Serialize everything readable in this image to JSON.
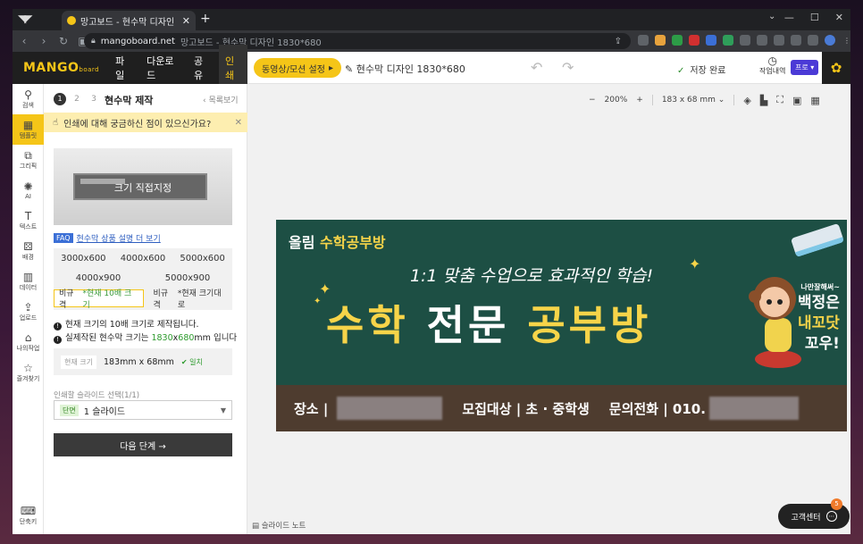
{
  "browser": {
    "tab_title": "망고보드 - 현수막 디자인 1",
    "url_host": "mangoboard.net",
    "url_rest": "망고보드 - 현수막 디자인 1830*680"
  },
  "header": {
    "logo": "MANGO",
    "logo_sub": "board",
    "menu": [
      "파일",
      "다운로드",
      "공유",
      "인쇄"
    ],
    "video_button": "동영상/모션 설정",
    "doc_title": "현수막 디자인 1830*680",
    "save_status": "저장 완료",
    "history": "작업내역",
    "pro_badge": "프로"
  },
  "sidebar": {
    "items": [
      "검색",
      "템플릿",
      "그리픽",
      "AI",
      "텍스트",
      "배경",
      "데이터",
      "업로드",
      "나의작업",
      "즐겨찾기"
    ],
    "bottom": "단축키"
  },
  "panel": {
    "steps": [
      "1",
      "2",
      "3"
    ],
    "title": "현수막 제작",
    "back": "목록보기",
    "notice": "인쇄에 대해 궁금하신 점이 있으신가요?",
    "preview_label": "크기 직접지정",
    "faq_tag": "FAQ",
    "faq_link": "현수막 상품 설명 더 보기",
    "sizes_row1": [
      "3000x600",
      "4000x600",
      "5000x600"
    ],
    "sizes_row2": [
      "4000x900",
      "5000x900"
    ],
    "custom1_a": "비규격",
    "custom1_b": "*현재 10배 크기",
    "custom2_a": "비규격",
    "custom2_b": "*현재 크기대로",
    "info1": "현재 크기의 10배 크기로 제작됩니다.",
    "info2_a": "실제작된 현수막 크기는 ",
    "info2_w": "1830",
    "info2_x": "x",
    "info2_h": "680",
    "info2_b": "mm 입니다",
    "cur_tag": "현재 크기",
    "cur_value": "183mm x 68mm",
    "cur_ok": "✔ 일치",
    "select_label": "인쇄할 슬라이드 선택(1/1)",
    "select_tag": "단면",
    "select_value": "1 슬라이드",
    "next": "다음 단계 →"
  },
  "canvas": {
    "zoom": "200%",
    "size": "183 x 68 mm",
    "slide_note": "슬라이드 노트",
    "help": "고객센터",
    "help_badge": "5"
  },
  "design": {
    "brand_a": "올림",
    "brand_b": "수학공부방",
    "subtitle": "1:1 맞춤 수업으로 효과적인 학습!",
    "main1": "수학",
    "main2": "전문",
    "main3": "공부방",
    "side1": "나만잘해써~",
    "side2": "백정은",
    "side3": "내꼬닷",
    "side4": "꼬우!",
    "footer_place": "장소 |",
    "footer_target": "모집대상 | 초 · 중학생",
    "footer_phone": "문의전화 | 010."
  },
  "colors": {
    "accent": "#f5c518",
    "board_green": "#1d4f44",
    "footer_brown": "#4e3c2f"
  }
}
